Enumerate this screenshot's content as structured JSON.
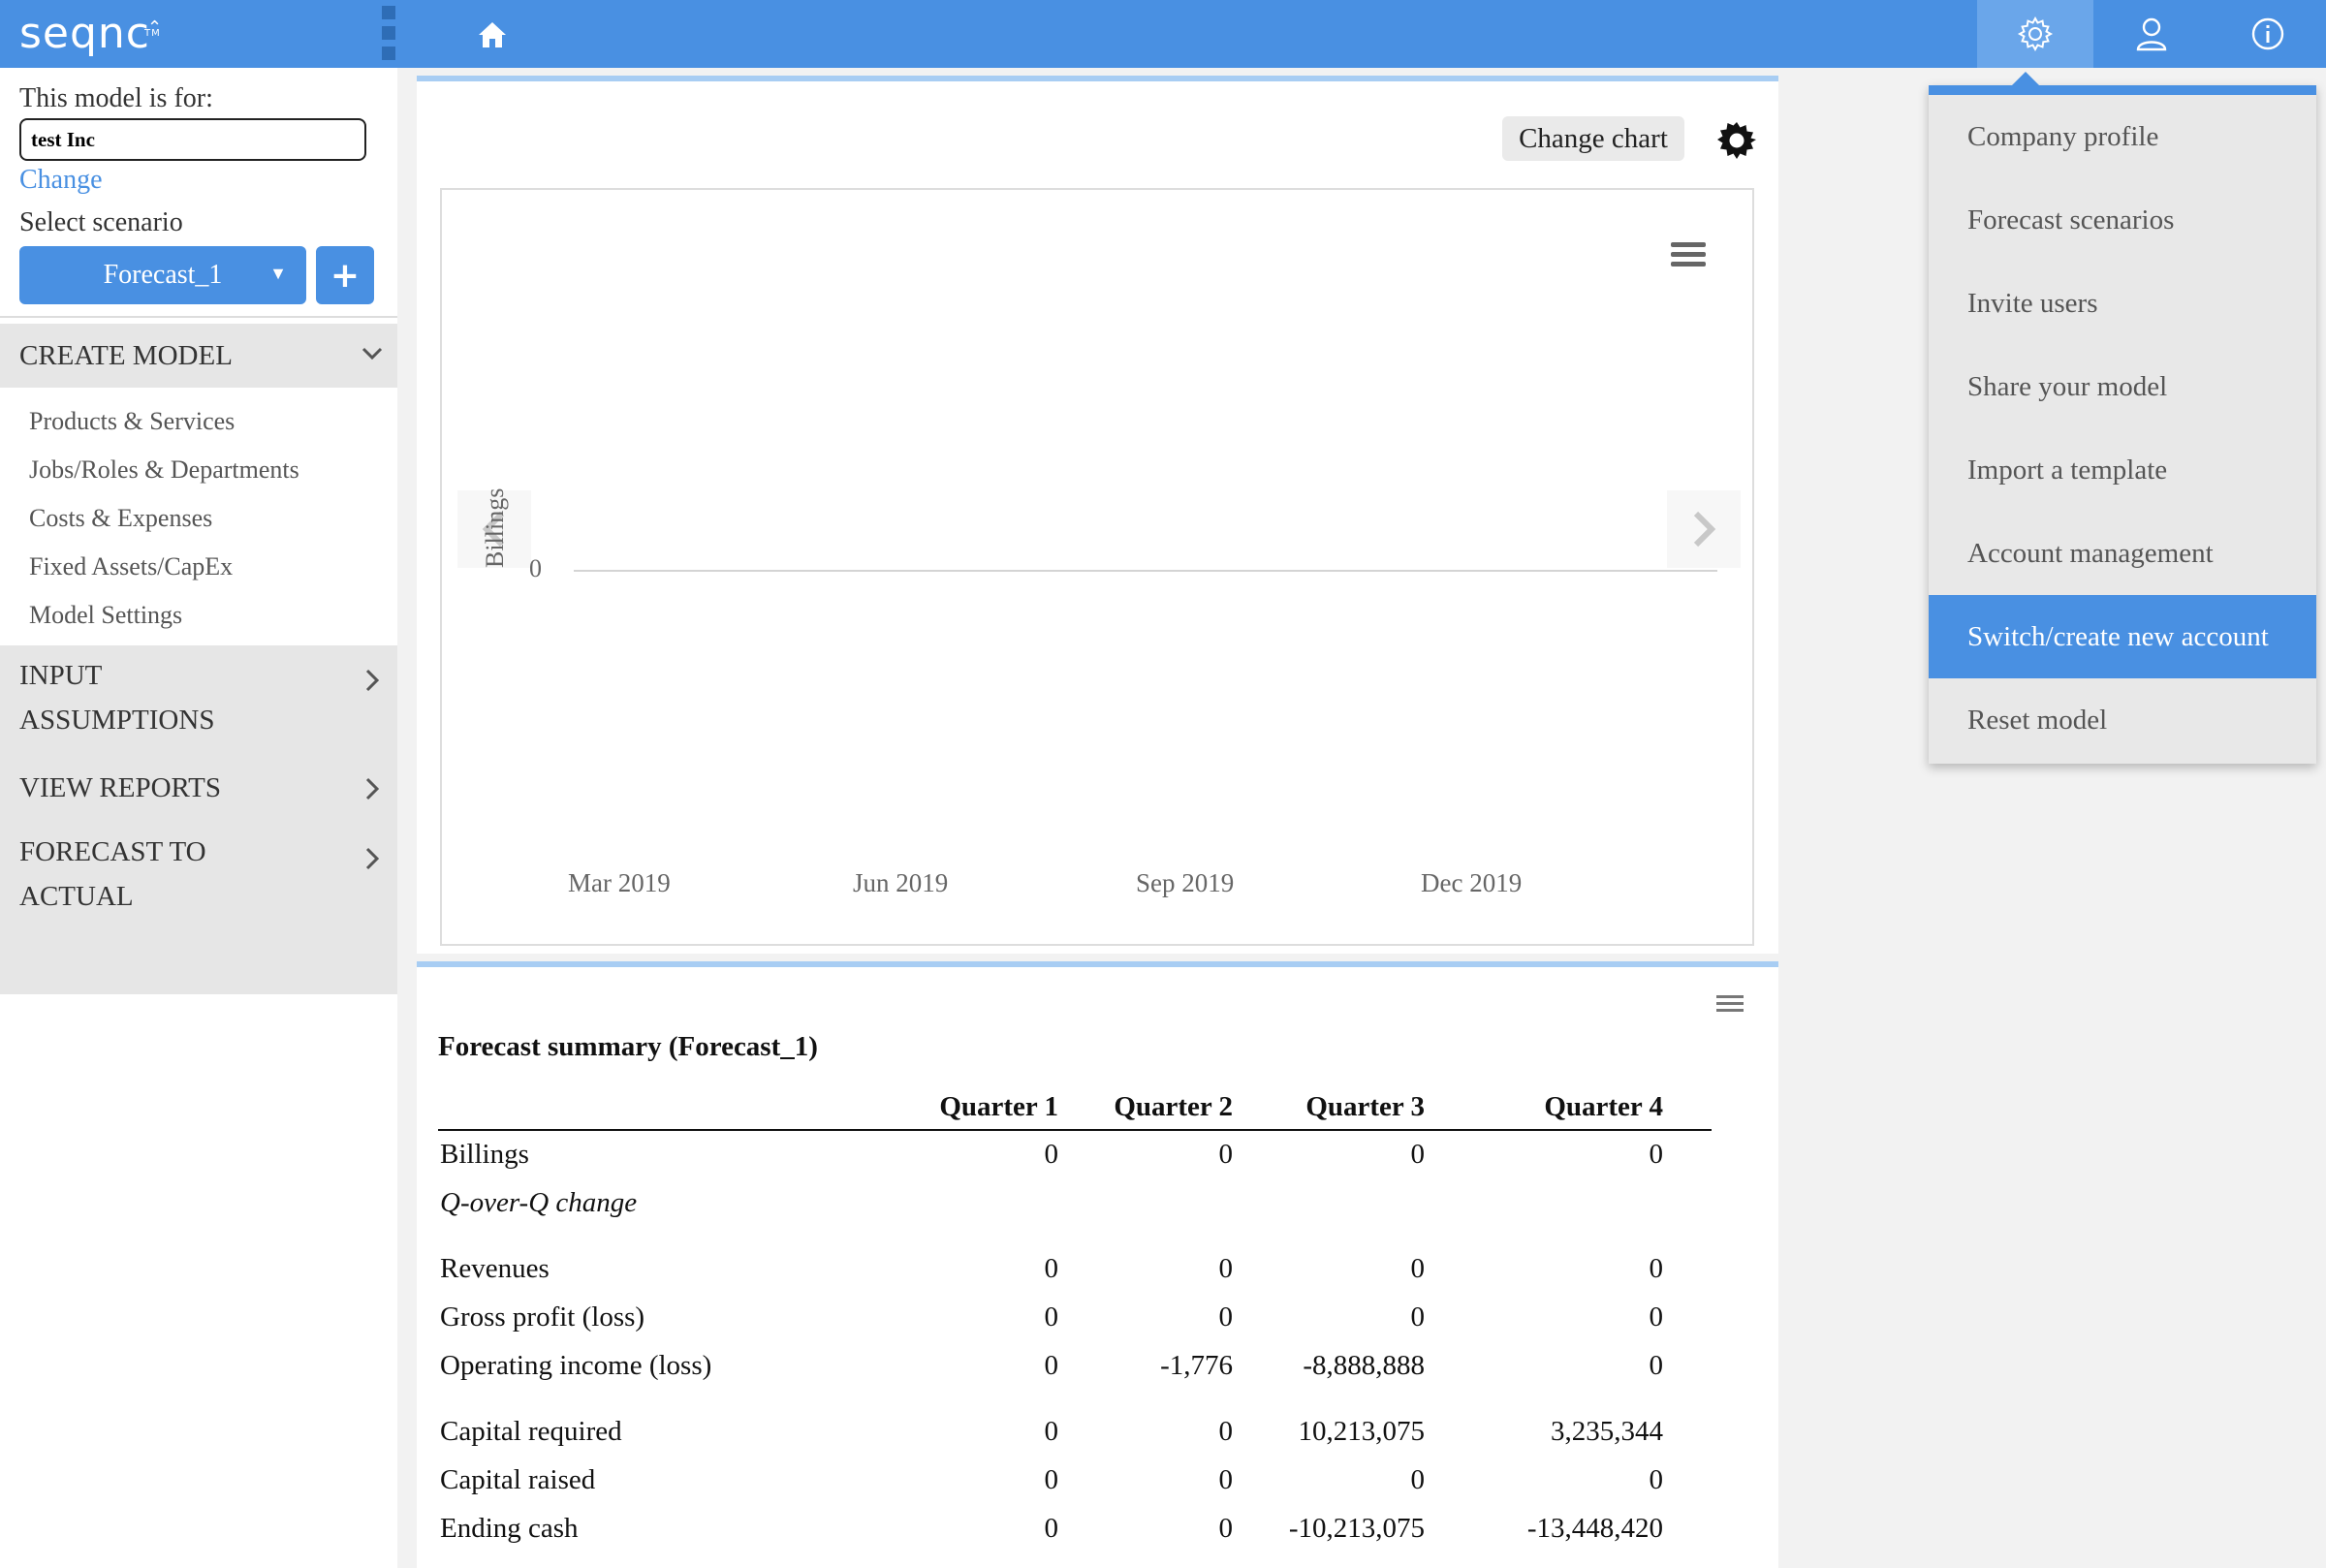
{
  "app": {
    "logo_text": "seqnc",
    "logo_tm": "TM",
    "logo_caret": "⌃"
  },
  "icons": {
    "home": "home-icon",
    "settings": "gear-icon",
    "user": "user-icon",
    "info": "info-icon",
    "chart_settings": "gear-icon",
    "chart_menu": "hamburger-icon",
    "table_menu": "hamburger-icon",
    "nav_prev": "chevron-left-icon",
    "nav_next": "chevron-right-icon"
  },
  "colors": {
    "primary": "#4990e2",
    "top_active": "#6aa6ea",
    "panel_border": "#a8cdf3",
    "sidebar_section": "#e6e6e6",
    "menu_bg": "#e8e8e8"
  },
  "sidebar": {
    "model_for_label": "This model is for:",
    "company_value": "test Inc",
    "change_link": "Change",
    "select_scenario_label": "Select scenario",
    "scenario_selected": "Forecast_1",
    "add_scenario_label": "+",
    "create_model": {
      "label": "CREATE MODEL",
      "items": [
        "Products & Services",
        "Jobs/Roles & Departments",
        "Costs & Expenses",
        "Fixed Assets/CapEx",
        "Model Settings"
      ]
    },
    "sections": {
      "input_assumptions": {
        "line1": "INPUT",
        "line2": "ASSUMPTIONS"
      },
      "view_reports": {
        "line1": "VIEW REPORTS"
      },
      "forecast_to_actual": {
        "line1": "FORECAST TO",
        "line2": "ACTUAL"
      }
    }
  },
  "chart_panel": {
    "change_chart_label": "Change chart"
  },
  "chart_data": {
    "type": "line",
    "ylabel": "Billings",
    "y_ticks": [
      "0"
    ],
    "x_ticks": [
      "Mar 2019",
      "Jun 2019",
      "Sep 2019",
      "Dec 2019"
    ],
    "series": [
      {
        "values": [
          0,
          0,
          0,
          0
        ]
      }
    ],
    "grid": false
  },
  "summary": {
    "title": "Forecast summary (Forecast_1)",
    "columns": [
      "",
      "Quarter 1",
      "Quarter 2",
      "Quarter 3",
      "Quarter 4"
    ],
    "rows": [
      {
        "label": "Billings",
        "values": [
          "0",
          "0",
          "0",
          "0"
        ]
      },
      {
        "label": "Q-over-Q change",
        "values": [
          "",
          "",
          "",
          ""
        ],
        "italic": true
      },
      {
        "gap": true
      },
      {
        "label": "Revenues",
        "values": [
          "0",
          "0",
          "0",
          "0"
        ]
      },
      {
        "label": "Gross profit (loss)",
        "values": [
          "0",
          "0",
          "0",
          "0"
        ]
      },
      {
        "label": "Operating income (loss)",
        "values": [
          "0",
          "-1,776",
          "-8,888,888",
          "0"
        ]
      },
      {
        "gap": true
      },
      {
        "label": "Capital required",
        "values": [
          "0",
          "0",
          "10,213,075",
          "3,235,344"
        ]
      },
      {
        "label": "Capital raised",
        "values": [
          "0",
          "0",
          "0",
          "0"
        ]
      },
      {
        "label": "Ending cash",
        "values": [
          "0",
          "0",
          "-10,213,075",
          "-13,448,420"
        ]
      }
    ]
  },
  "settings_menu": {
    "items": [
      {
        "label": "Company profile",
        "highlighted": false
      },
      {
        "label": "Forecast scenarios",
        "highlighted": false
      },
      {
        "label": "Invite users",
        "highlighted": false
      },
      {
        "label": "Share your model",
        "highlighted": false
      },
      {
        "label": "Import a template",
        "highlighted": false
      },
      {
        "label": "Account management",
        "highlighted": false
      },
      {
        "label": "Switch/create new account",
        "highlighted": true
      },
      {
        "label": "Reset model",
        "highlighted": false
      }
    ]
  }
}
